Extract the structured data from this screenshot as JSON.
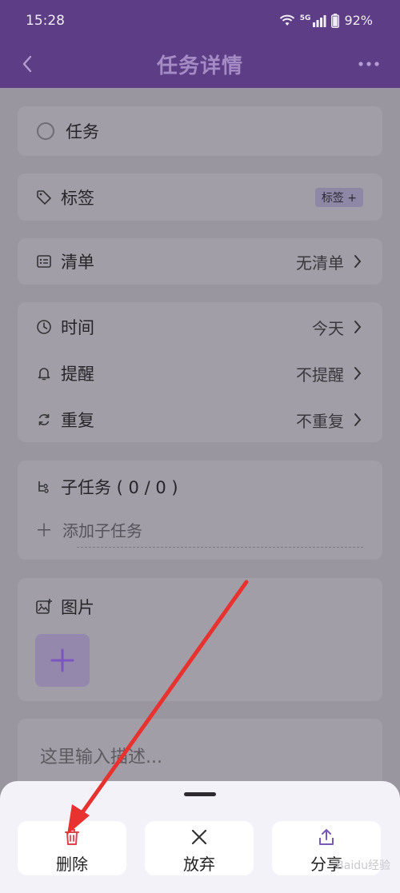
{
  "status": {
    "time": "15:28",
    "network": "5G",
    "battery": "92%"
  },
  "header": {
    "title": "任务详情"
  },
  "task": {
    "name": "任务"
  },
  "tags": {
    "label": "标签",
    "chip": "标签 +"
  },
  "list": {
    "label": "清单",
    "value": "无清单"
  },
  "schedule": {
    "time_label": "时间",
    "time_value": "今天",
    "reminder_label": "提醒",
    "reminder_value": "不提醒",
    "repeat_label": "重复",
    "repeat_value": "不重复"
  },
  "subtasks": {
    "label": "子任务 ( 0 / 0 )",
    "add_label": "添加子任务"
  },
  "images": {
    "label": "图片"
  },
  "description": {
    "placeholder": "这里输入描述..."
  },
  "actions": {
    "delete": "删除",
    "discard": "放弃",
    "share": "分享"
  },
  "colors": {
    "header": "#5c3d86",
    "delete_icon": "#e0424a",
    "share_icon": "#7b57b8",
    "arrow": "#e8322f"
  },
  "watermark": "Baidu经验"
}
